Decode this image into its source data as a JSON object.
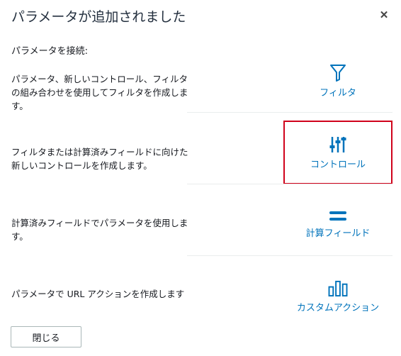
{
  "dialog": {
    "title": "パラメータが追加されました",
    "close_symbol": "✕",
    "intro": "パラメータを接続:",
    "close_button_label": "閉じる"
  },
  "options": [
    {
      "description": "パラメータ、新しいコントロール、フィルタの組み合わせを使用してフィルタを作成します。",
      "action_label": "フィルタ",
      "icon": "filter-icon"
    },
    {
      "description": "フィルタまたは計算済みフィールドに向けた新しいコントロールを作成します。",
      "action_label": "コントロール",
      "icon": "sliders-icon",
      "selected": true
    },
    {
      "description": "計算済みフィールドでパラメータを使用します。",
      "action_label": "計算フィールド",
      "icon": "equals-icon"
    },
    {
      "description": "パラメータで URL アクションを作成します",
      "action_label": "カスタムアクション",
      "icon": "bar-chart-icon"
    }
  ],
  "colors": {
    "accent": "#0073bb",
    "selection_border": "#d0021b"
  }
}
